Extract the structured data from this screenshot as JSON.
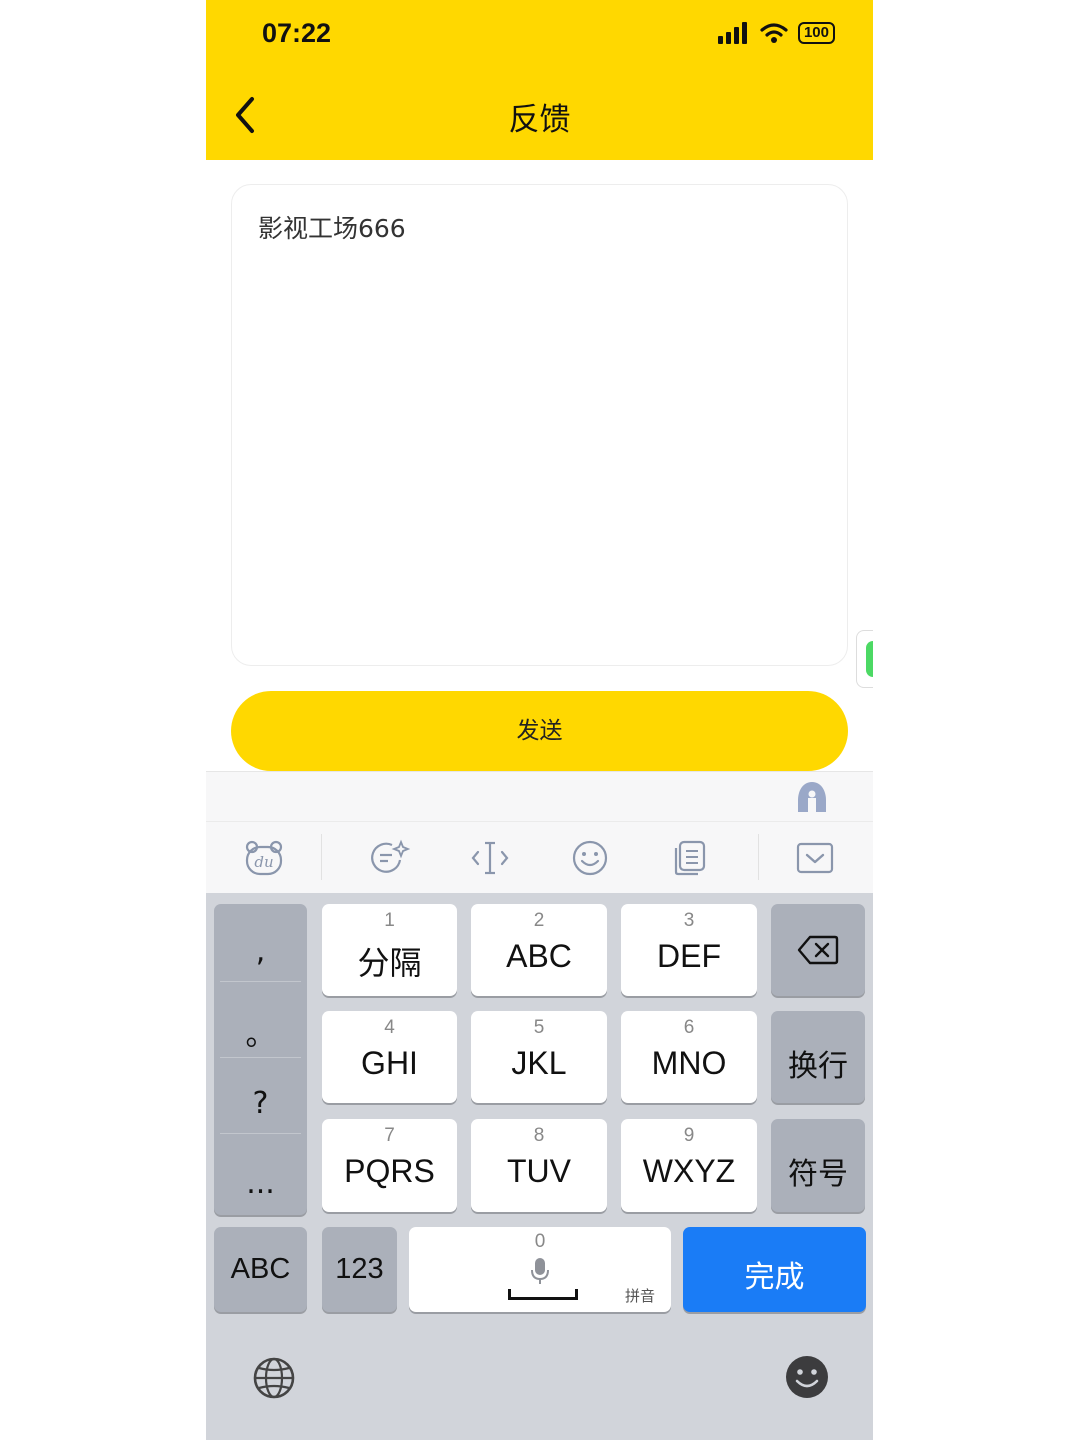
{
  "status_bar": {
    "time": "07:22",
    "battery": "100"
  },
  "nav": {
    "title": "反馈"
  },
  "feedback": {
    "text": "影视工场666"
  },
  "send_button": {
    "label": "发送"
  },
  "keyboard": {
    "keys": [
      {
        "num": "1",
        "label": "分隔"
      },
      {
        "num": "2",
        "label": "ABC"
      },
      {
        "num": "3",
        "label": "DEF"
      },
      {
        "num": "4",
        "label": "GHI"
      },
      {
        "num": "5",
        "label": "JKL"
      },
      {
        "num": "6",
        "label": "MNO"
      },
      {
        "num": "7",
        "label": "PQRS"
      },
      {
        "num": "8",
        "label": "TUV"
      },
      {
        "num": "9",
        "label": "WXYZ"
      }
    ],
    "punctuation": [
      ",",
      "。",
      "?",
      "..."
    ],
    "newline": "换行",
    "symbols": "符号",
    "abc": "ABC",
    "num123": "123",
    "space_num": "0",
    "space_label": "拼音",
    "done": "完成"
  },
  "icons": {
    "back": "chevron-left-icon",
    "signal": "cellular-signal-icon",
    "wifi": "wifi-icon",
    "toolbar": [
      "baidu-bear-icon",
      "ai-write-icon",
      "cursor-icon",
      "emoji-icon",
      "clipboard-icon",
      "keyboard-hide-icon"
    ],
    "globe": "globe-icon",
    "smiley": "smiley-icon",
    "delete": "backspace-icon",
    "mic": "microphone-icon"
  },
  "colors": {
    "brand_yellow": "#FFD800",
    "done_blue": "#1A7CF6",
    "keyboard_bg": "#D1D4DA"
  }
}
